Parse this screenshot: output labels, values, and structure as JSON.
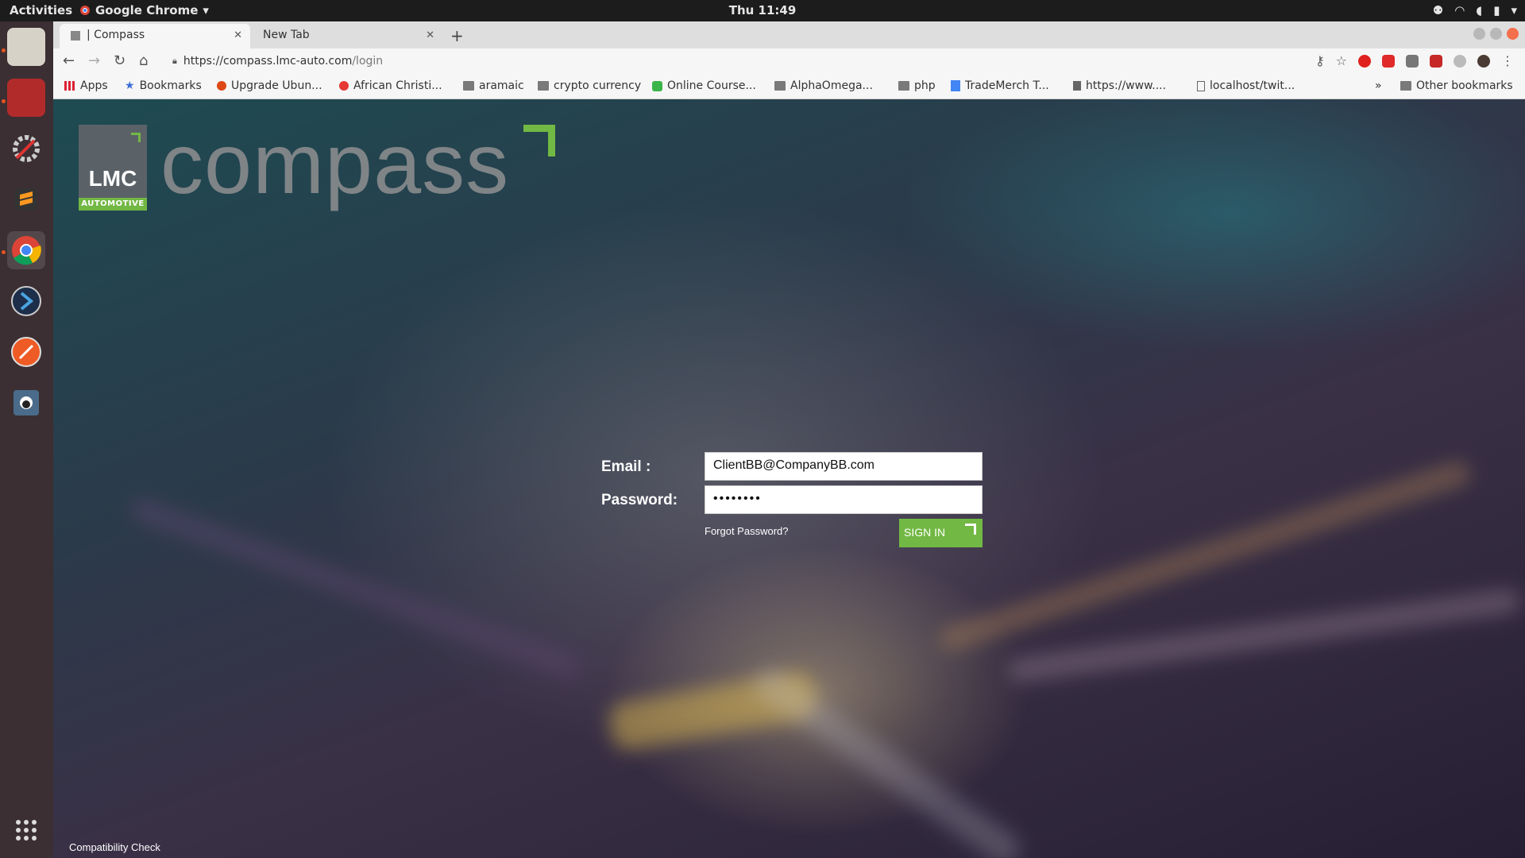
{
  "topbar": {
    "activities": "Activities",
    "app_name": "Google Chrome",
    "clock": "Thu 11:49"
  },
  "tabs": [
    {
      "label": "| Compass",
      "active": true
    },
    {
      "label": "New Tab",
      "active": false
    }
  ],
  "address_bar": {
    "host": "https://compass.lmc-auto.com",
    "path": "/login"
  },
  "bookmarks": [
    {
      "label": "Apps",
      "icon": "apps-grid-icon"
    },
    {
      "label": "Bookmarks",
      "icon": "star-icon"
    },
    {
      "label": "Upgrade Ubun...",
      "icon": "ubuntu-icon"
    },
    {
      "label": "African Christi...",
      "icon": "site-icon"
    },
    {
      "label": "aramaic",
      "icon": "folder-icon"
    },
    {
      "label": "crypto currency",
      "icon": "folder-icon"
    },
    {
      "label": "Online Course...",
      "icon": "udemy-icon"
    },
    {
      "label": "AlphaOmega...",
      "icon": "folder-icon"
    },
    {
      "label": "php",
      "icon": "folder-icon"
    },
    {
      "label": "TradeMerch T...",
      "icon": "doc-icon"
    },
    {
      "label": "https://www....",
      "icon": "site-icon"
    },
    {
      "label": "localhost/twit...",
      "icon": "page-icon"
    }
  ],
  "bookmarks_overflow": "»",
  "other_bookmarks": "Other bookmarks",
  "logo": {
    "lmc": "LMC",
    "automotive": "AUTOMOTIVE",
    "wordmark": "compass"
  },
  "login": {
    "email_label": "Email :",
    "email_value": "ClientBB@CompanyBB.com",
    "password_label": "Password:",
    "password_value": "••••••••",
    "forgot": "Forgot Password?",
    "signin": "SIGN IN"
  },
  "footer": {
    "compat": "Compatibility Check"
  },
  "colors": {
    "accent_green": "#72b844",
    "logo_gray": "#5a6268",
    "wordmark_gray": "#7f8487",
    "ubuntu_orange": "#e95420"
  }
}
